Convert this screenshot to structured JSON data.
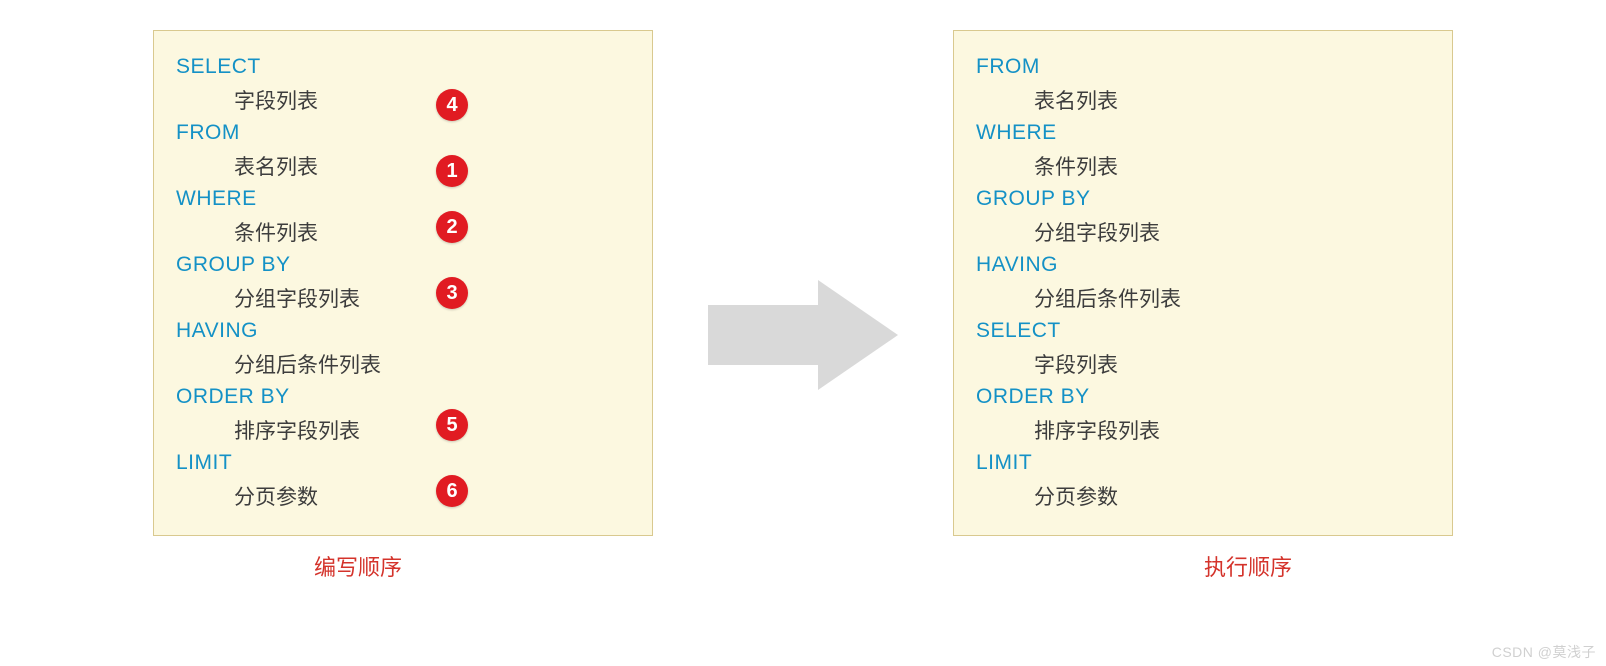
{
  "left": {
    "caption": "编写顺序",
    "items": [
      {
        "kw": "SELECT",
        "sub": "字段列表",
        "badge": "4",
        "badgeTop": 34
      },
      {
        "kw": "FROM",
        "sub": "表名列表",
        "badge": "1",
        "badgeTop": 34
      },
      {
        "kw": "WHERE",
        "sub": "条件列表",
        "badge": "2",
        "badgeTop": 24
      },
      {
        "kw": "GROUP  BY",
        "sub": "分组字段列表",
        "badge": "3",
        "badgeTop": 24
      },
      {
        "kw": "HAVING",
        "sub": "分组后条件列表",
        "badge": "",
        "badgeTop": 0
      },
      {
        "kw": "ORDER BY",
        "sub": "排序字段列表",
        "badge": "5",
        "badgeTop": 24
      },
      {
        "kw": "LIMIT",
        "sub": "分页参数",
        "badge": "6",
        "badgeTop": 24
      }
    ]
  },
  "right": {
    "caption": "执行顺序",
    "items": [
      {
        "kw": "FROM",
        "sub": "表名列表"
      },
      {
        "kw": "WHERE",
        "sub": "条件列表"
      },
      {
        "kw": "GROUP  BY",
        "sub": "分组字段列表"
      },
      {
        "kw": "HAVING",
        "sub": "分组后条件列表"
      },
      {
        "kw": " SELECT",
        "sub": "字段列表"
      },
      {
        "kw": "ORDER BY",
        "sub": "排序字段列表"
      },
      {
        "kw": "LIMIT",
        "sub": "分页参数"
      }
    ]
  },
  "watermark": "CSDN @莫浅子"
}
